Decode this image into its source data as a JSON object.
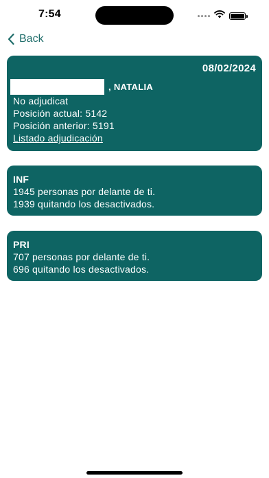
{
  "status_bar": {
    "time": "7:54",
    "icons": [
      "signal-dots-icon",
      "wifi-icon",
      "battery-icon"
    ]
  },
  "nav": {
    "back_label": "Back",
    "accent_color": "#1f6d6a"
  },
  "main_card": {
    "date": "08/02/2024",
    "name": ", NATALIA",
    "status": "No adjudicat",
    "current_position": "Posición actual: 5142",
    "previous_position": "Posición anterior: 5191",
    "listing_link": "Listado adjudicación",
    "card_color": "#0e6463"
  },
  "cards": [
    {
      "title": "INF",
      "ahead": "1945 personas por delante de ti.",
      "without_deactivated": "1939 quitando los desactivados."
    },
    {
      "title": "PRI",
      "ahead": "707 personas por delante de ti.",
      "without_deactivated": "696 quitando los desactivados."
    }
  ]
}
